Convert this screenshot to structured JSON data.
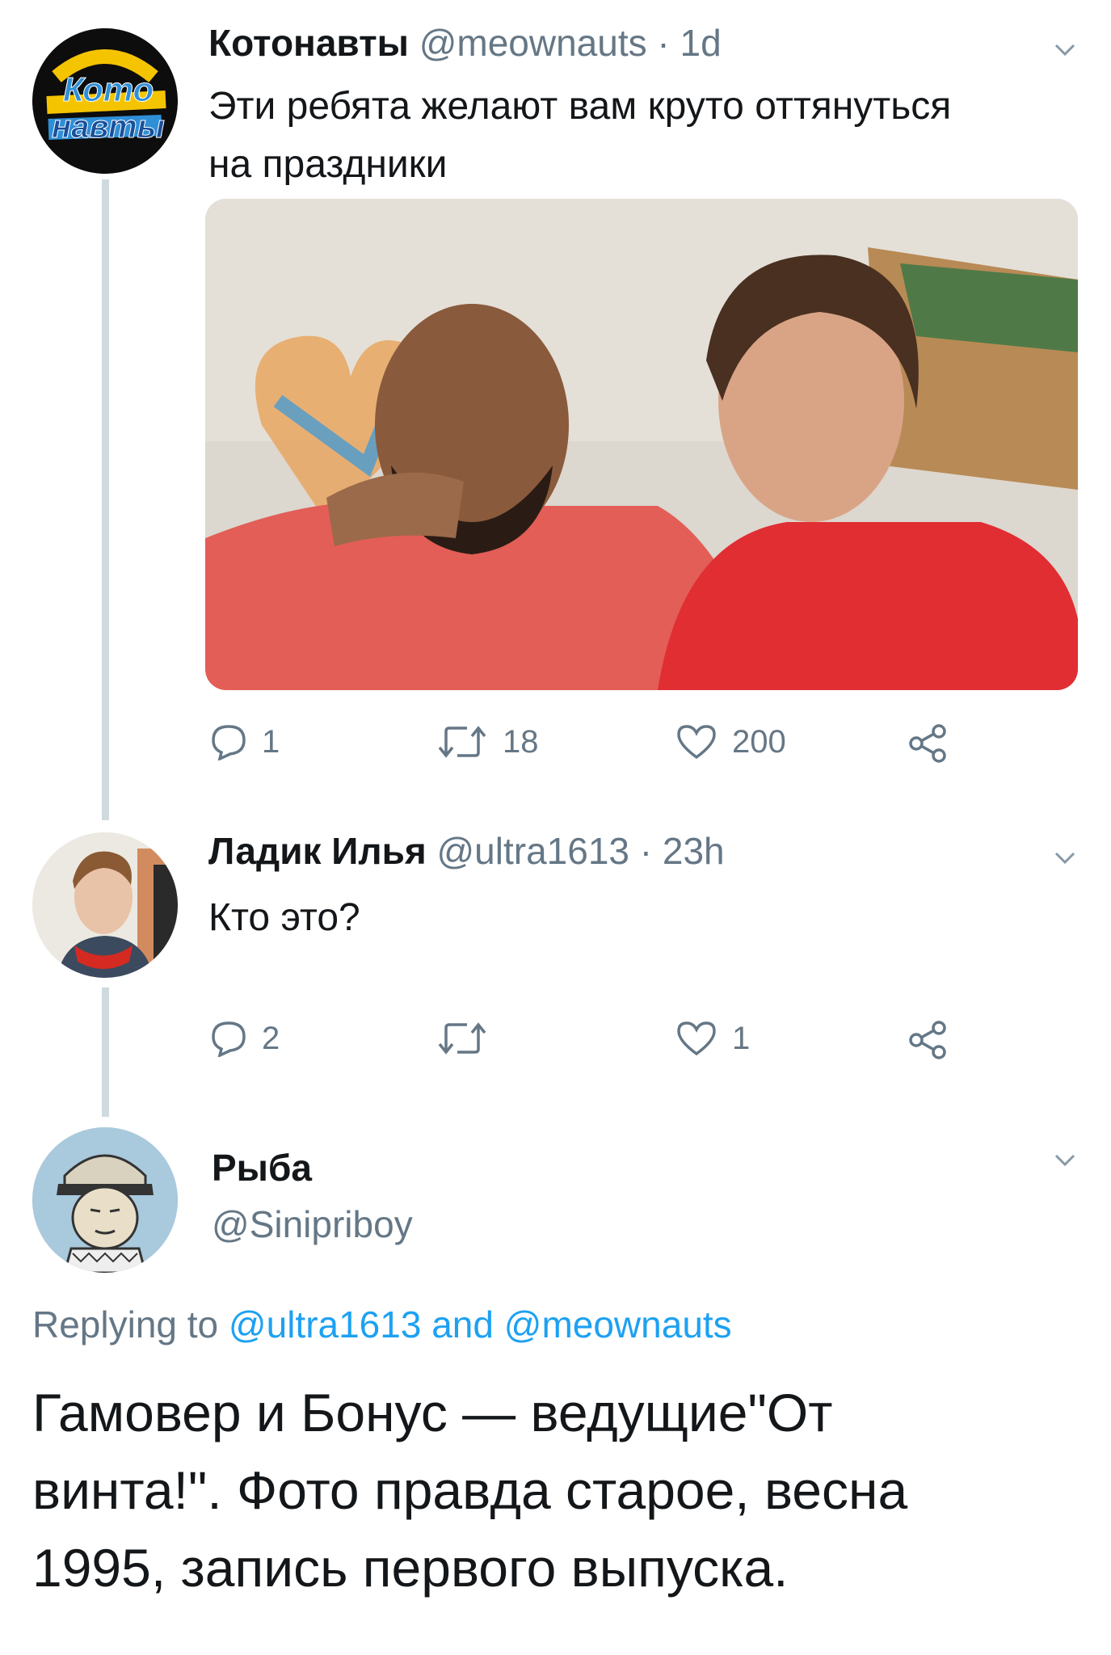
{
  "tweet1": {
    "display_name": "Котонавты",
    "handle": "@meownauts",
    "separator": "·",
    "time": "1d",
    "text_line1": "Эти ребята желают вам круто оттянуться",
    "text_line2": "на праздники",
    "avatar_logo_line1": "Кото",
    "avatar_logo_line2": "навты",
    "replies": "1",
    "retweets": "18",
    "likes": "200"
  },
  "tweet2": {
    "display_name": "Ладик Илья",
    "handle": "@ultra1613",
    "separator": "·",
    "time": "23h",
    "text": "Кто это?",
    "replies": "2",
    "likes": "1"
  },
  "tweet3": {
    "display_name": "Рыба",
    "handle": "@Sinipriboy",
    "replying_prefix": "Replying to",
    "reply_handle1": "@ultra1613",
    "reply_and": "and",
    "reply_handle2": "@meownauts",
    "text_line1": "Гамовер и Бонус — ведущие\"От",
    "text_line2": "винта!\". Фото правда старое, весна",
    "text_line3": "1995, запись первого выпуска."
  },
  "colors": {
    "link_blue": "#1da1f2",
    "secondary_gray": "#657786",
    "thread_line": "#cfd9de",
    "hoodie_red": "#e0453f"
  },
  "icons": [
    "chevron-down-icon",
    "reply-icon",
    "retweet-icon",
    "like-icon",
    "share-icon"
  ]
}
